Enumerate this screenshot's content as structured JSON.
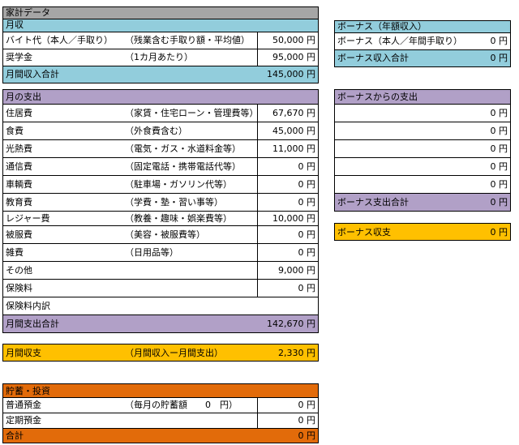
{
  "income": {
    "sheet_title": "家計データ",
    "header": "月収",
    "rows": [
      {
        "label": "バイト代（本人／手取り）",
        "note": "（残業含む手取り額・平均値）",
        "value": "50,000 円"
      },
      {
        "label": "奨学金",
        "note": "（1カ月あたり）",
        "value": "95,000 円"
      }
    ],
    "total": {
      "label": "月間収入合計",
      "value": "145,000 円"
    }
  },
  "bonus_income": {
    "header": "ボーナス（年額収入）",
    "row": {
      "label": "ボーナス（本人／年間手取り）",
      "value": "0 円"
    },
    "total": {
      "label": "ボーナス収入合計",
      "value": "0 円"
    }
  },
  "expenses": {
    "header": "月の支出",
    "rows": [
      {
        "label": "住居費",
        "note": "（家賃・住宅ローン・管理費等）",
        "value": "67,670 円"
      },
      {
        "label": "食費",
        "note": "（外食費含む）",
        "value": "45,000 円"
      },
      {
        "label": "光熱費",
        "note": "（電気・ガス・水道料金等）",
        "value": "11,000 円"
      },
      {
        "label": "通信費",
        "note": "（固定電話・携帯電話代等）",
        "value": "0 円"
      },
      {
        "label": "車輌費",
        "note": "（駐車場・ガソリン代等）",
        "value": "0 円"
      },
      {
        "label": "教育費",
        "note": "（学費・塾・習い事等）",
        "value": "0 円"
      },
      {
        "label": "レジャー費",
        "note": "（教養・趣味・娯楽費等）",
        "value": "10,000 円"
      },
      {
        "label": "被服費",
        "note": "（美容・被服費等）",
        "value": "0 円"
      },
      {
        "label": "雑費",
        "note": "（日用品等）",
        "value": "0 円"
      },
      {
        "label": "その他",
        "note": "",
        "value": "9,000 円"
      },
      {
        "label": "保険料",
        "note": "",
        "value": "0 円"
      }
    ],
    "insurance_detail_label": "保険料内訳",
    "total": {
      "label": "月間支出合計",
      "value": "142,670 円"
    }
  },
  "bonus_expenses": {
    "header": "ボーナスからの支出",
    "rows": [
      "0 円",
      "0 円",
      "0 円",
      "0 円",
      "0 円"
    ],
    "total": {
      "label": "ボーナス支出合計",
      "value": "0 円"
    },
    "balance": {
      "label": "ボーナス収支",
      "value": "0 円"
    }
  },
  "monthly_balance": {
    "label": "月間収支",
    "note": "（月間収入ー月間支出）",
    "value": "2,330 円"
  },
  "savings": {
    "header": "貯蓄・投資",
    "rows": [
      {
        "label": "普通預金",
        "note": "（毎月の貯蓄額　　0　円）",
        "value": "0 円"
      },
      {
        "label": "定期預金",
        "note": "",
        "value": "0 円"
      }
    ],
    "total": {
      "label": "合計",
      "value": "0 円"
    }
  },
  "colors": {
    "title_gray": "#a6a6a6",
    "income_blue": "#92cddc",
    "expense_purple": "#b1a0c7",
    "balance_gold": "#ffc000",
    "savings_orange": "#e26b0a"
  }
}
